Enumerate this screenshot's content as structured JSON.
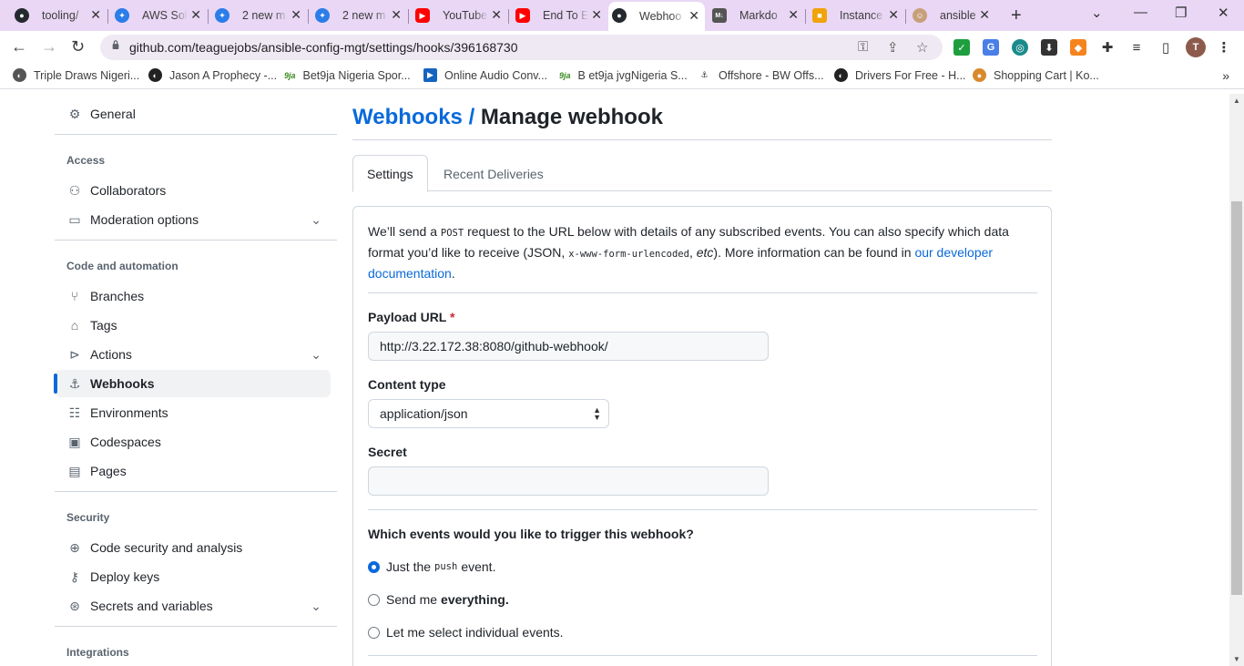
{
  "browser": {
    "tabs": [
      {
        "title": "tooling/",
        "icon": "github-icon"
      },
      {
        "title": "AWS Sol",
        "icon": "copilot-icon"
      },
      {
        "title": "2 new m",
        "icon": "copilot-icon"
      },
      {
        "title": "2 new m",
        "icon": "copilot-icon"
      },
      {
        "title": "YouTube",
        "icon": "youtube-icon"
      },
      {
        "title": "End To E",
        "icon": "youtube-icon"
      },
      {
        "title": "Webhoo",
        "icon": "github-icon"
      },
      {
        "title": "Markdo",
        "icon": "markdown-icon"
      },
      {
        "title": "Instance",
        "icon": "aws-box-icon"
      },
      {
        "title": "ansible",
        "icon": "avatar-icon"
      }
    ],
    "url": "github.com/teaguejobs/ansible-config-mgt/settings/hooks/396168730",
    "profile_initial": "T",
    "bookmarks": [
      "Triple Draws Nigeri...",
      "Jason A Prophecy -...",
      "Bet9ja Nigeria Spor...",
      "Online Audio Conv...",
      "B et9ja jvgNigeria S...",
      "Offshore - BW Offs...",
      "Drivers For Free - H...",
      "Shopping Cart | Ko..."
    ],
    "bookmark_badge_9ja": "9ja"
  },
  "sidebar": {
    "general": "General",
    "access_heading": "Access",
    "collaborators": "Collaborators",
    "moderation": "Moderation options",
    "code_heading": "Code and automation",
    "branches": "Branches",
    "tags": "Tags",
    "actions": "Actions",
    "webhooks": "Webhooks",
    "environments": "Environments",
    "codespaces": "Codespaces",
    "pages": "Pages",
    "security_heading": "Security",
    "code_security": "Code security and analysis",
    "deploy_keys": "Deploy keys",
    "secrets": "Secrets and variables",
    "integrations_heading": "Integrations"
  },
  "main": {
    "breadcrumb": "Webhooks",
    "separator": " / ",
    "title": "Manage webhook",
    "tabs": [
      "Settings",
      "Recent Deliveries"
    ],
    "intro": {
      "p1": "We’ll send a ",
      "post": "POST",
      "p2": " request to the URL below with details of any subscribed events. You can also specify which data format you’d like to receive (JSON, ",
      "form": "x-www-form-urlencoded",
      "p3": ", ",
      "etc": "etc",
      "p4": "). More information can be found in ",
      "link": "our developer documentation",
      "p5": "."
    },
    "payload_label": "Payload URL",
    "required_mark": "*",
    "payload_value": "http://3.22.172.38:8080/github-webhook/",
    "content_type_label": "Content type",
    "content_type_value": "application/json",
    "secret_label": "Secret",
    "secret_value": "",
    "events_question": "Which events would you like to trigger this webhook?",
    "events": {
      "opt1_pre": "Just the",
      "opt1_code": "push",
      "opt1_post": "event.",
      "opt2_pre": "Send me",
      "opt2_bold": "everything.",
      "opt3": "Let me select individual events.",
      "selected": 0
    }
  },
  "colors": {
    "link": "#0969da",
    "tabstrip": "#e9d7f5",
    "active_indicator": "#0969da"
  }
}
